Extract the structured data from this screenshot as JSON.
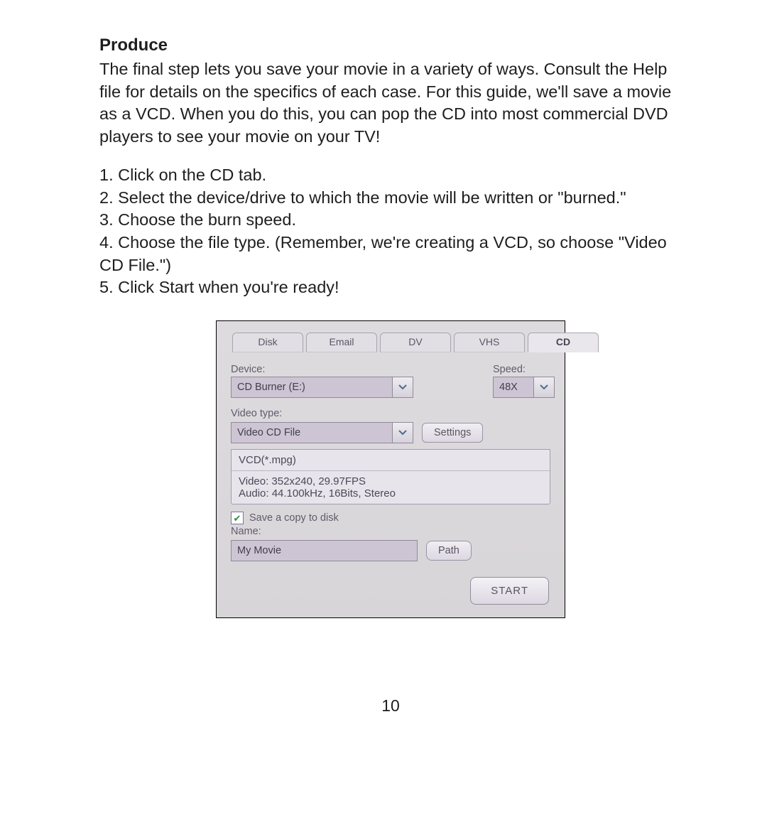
{
  "doc": {
    "heading": "Produce",
    "paragraph": "The final step lets you save your movie in a variety of ways. Consult the Help file for details on the specifics of each case. For this guide, we'll save a movie as a VCD. When you do this, you can pop the CD into most commercial DVD players to see your movie on your TV!",
    "steps": [
      "1. Click on the CD tab.",
      "2. Select the device/drive to which the movie will be written or \"burned.\"",
      "3. Choose the burn speed.",
      "4. Choose the file type. (Remember, we're creating a VCD, so choose \"Video CD File.\")",
      "5. Click Start when you're ready!"
    ],
    "page_number": "10"
  },
  "dialog": {
    "tabs": [
      "Disk",
      "Email",
      "DV",
      "VHS",
      "CD"
    ],
    "active_tab": "CD",
    "device_label": "Device:",
    "device_value": "CD Burner (E:)",
    "speed_label": "Speed:",
    "speed_value": "48X",
    "video_type_label": "Video type:",
    "video_type_value": "Video CD File",
    "settings_label": "Settings",
    "format_line": "VCD(*.mpg)",
    "video_line": "Video: 352x240, 29.97FPS",
    "audio_line": "Audio: 44.100kHz, 16Bits, Stereo",
    "save_copy_label": "Save a copy to disk",
    "save_copy_checked": true,
    "name_label": "Name:",
    "name_value": "My Movie",
    "path_label": "Path",
    "start_label": "START"
  }
}
